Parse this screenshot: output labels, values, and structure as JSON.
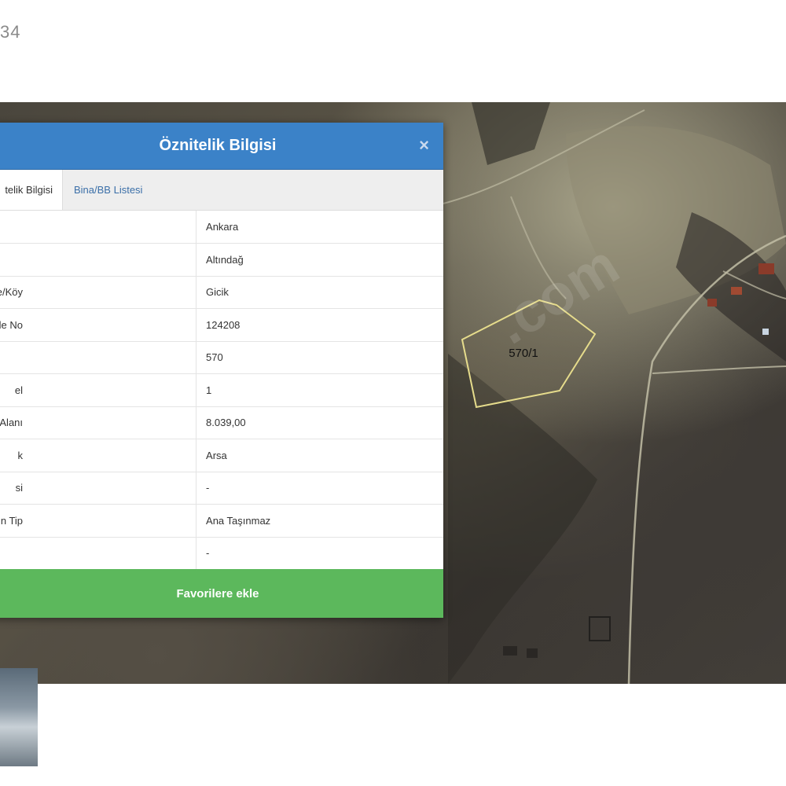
{
  "page": {
    "counter_text": "34"
  },
  "map": {
    "parcel_label": "570/1",
    "watermark": ".com",
    "colors": {
      "parcel_outline": "#e6dc8c",
      "road": "#b8b49c"
    }
  },
  "dialog": {
    "title": "Öznitelik Bilgisi",
    "close_symbol": "×",
    "tabs": [
      {
        "label": "telik Bilgisi",
        "active": true
      },
      {
        "label": "Bina/BB Listesi",
        "active": false
      }
    ],
    "rows": [
      {
        "key": "",
        "value": "Ankara"
      },
      {
        "key": "",
        "value": "Altındağ"
      },
      {
        "key": "lle/Köy",
        "value": "Gicik"
      },
      {
        "key": "lle No",
        "value": "124208"
      },
      {
        "key": "",
        "value": "570"
      },
      {
        "key": "el",
        "value": "1"
      },
      {
        "key": "Alanı",
        "value": "8.039,00"
      },
      {
        "key": "k",
        "value": "Arsa"
      },
      {
        "key": "si",
        "value": "-"
      },
      {
        "key": "n Tip",
        "value": "Ana Taşınmaz"
      },
      {
        "key": "",
        "value": "-"
      }
    ],
    "button_label": "Favorilere ekle",
    "colors": {
      "header": "#3b82c8",
      "button": "#5cb85c"
    }
  }
}
